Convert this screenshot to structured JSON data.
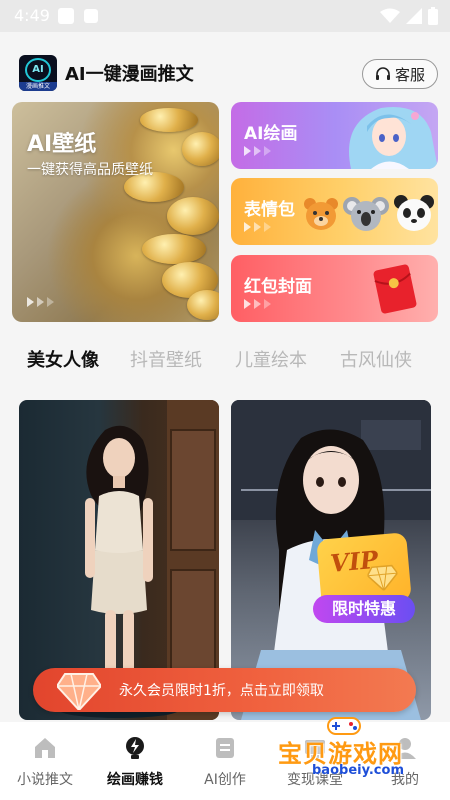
{
  "status_bar": {
    "time": "4:49"
  },
  "header": {
    "app_title": "AI一键漫画推文",
    "logo_text": "AI",
    "logo_caption": "漫画推文",
    "service_label": "客服"
  },
  "features": {
    "wallpaper": {
      "title": "AI壁纸",
      "subtitle": "一键获得高品质壁纸"
    },
    "ai_drawing": {
      "title": "AI绘画"
    },
    "emoji": {
      "title": "表情包"
    },
    "red_packet": {
      "title": "红包封面"
    }
  },
  "tabs": [
    {
      "label": "美女人像",
      "active": true
    },
    {
      "label": "抖音壁纸",
      "active": false
    },
    {
      "label": "儿童绘本",
      "active": false
    },
    {
      "label": "古风仙侠",
      "active": false
    }
  ],
  "vip_card": {
    "badge": "VIP",
    "offer": "限时特惠"
  },
  "promo_banner": {
    "text": "永久会员限时1折，点击立即领取"
  },
  "bottom_nav": [
    {
      "label": "小说推文",
      "icon": "home-icon",
      "active": false
    },
    {
      "label": "绘画赚钱",
      "icon": "lightning-bulb-icon",
      "active": true
    },
    {
      "label": "AI创作",
      "icon": "document-icon",
      "active": false
    },
    {
      "label": "变现课堂",
      "icon": "classroom-icon",
      "active": false
    },
    {
      "label": "我的",
      "icon": "profile-icon",
      "active": false
    }
  ],
  "watermark": {
    "main": "宝贝游戏网",
    "sub": "baobeiy.com"
  },
  "colors": {
    "accent_orange": "#f0623f",
    "ai_card": "#c46ce6",
    "emoji_card": "#ffb13c",
    "red_card": "#ff5f64",
    "vip_purple": "#6b4ef2"
  }
}
